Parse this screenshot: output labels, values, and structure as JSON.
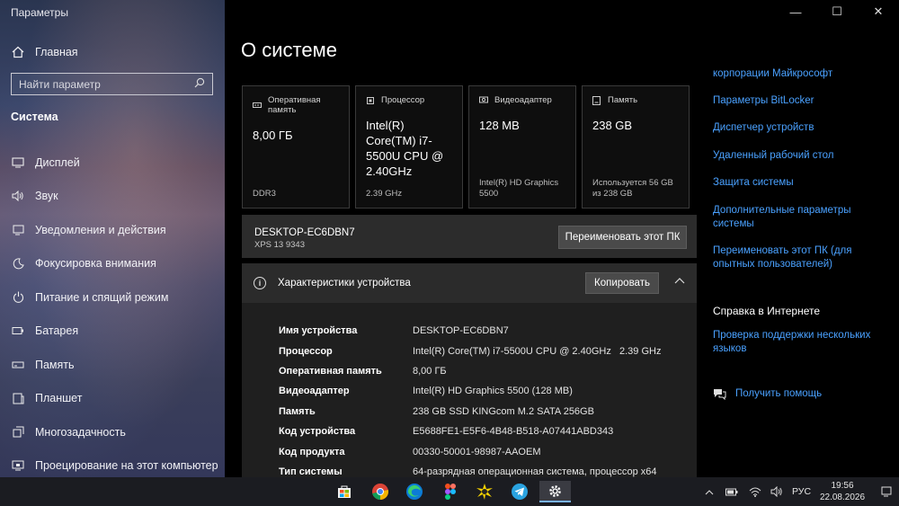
{
  "window": {
    "app_title": "Параметры",
    "controls": {
      "minimize": "—",
      "maximize": "☐",
      "close": "✕"
    }
  },
  "sidebar": {
    "home_label": "Главная",
    "search_placeholder": "Найти параметр",
    "section_label": "Система",
    "items": [
      {
        "label": "Дисплей",
        "icon": "display-icon"
      },
      {
        "label": "Звук",
        "icon": "speaker-icon"
      },
      {
        "label": "Уведомления и действия",
        "icon": "notification-icon"
      },
      {
        "label": "Фокусировка внимания",
        "icon": "moon-icon"
      },
      {
        "label": "Питание и спящий режим",
        "icon": "power-icon"
      },
      {
        "label": "Батарея",
        "icon": "battery-icon"
      },
      {
        "label": "Память",
        "icon": "storage-icon"
      },
      {
        "label": "Планшет",
        "icon": "tablet-icon"
      },
      {
        "label": "Многозадачность",
        "icon": "multitask-icon"
      },
      {
        "label": "Проецирование на этот компьютер",
        "icon": "project-icon"
      }
    ]
  },
  "main": {
    "page_title": "О системе",
    "cards": [
      {
        "title": "Оперативная память",
        "value": "8,00 ГБ",
        "footer": "DDR3",
        "icon": "ram-icon"
      },
      {
        "title": "Процессор",
        "value": "Intel(R) Core(TM) i7-5500U CPU @ 2.40GHz",
        "footer": "2.39 GHz",
        "icon": "cpu-icon"
      },
      {
        "title": "Видеоадаптер",
        "value": "128 MB",
        "footer": "Intel(R) HD Graphics 5500",
        "icon": "gpu-icon"
      },
      {
        "title": "Память",
        "value": "238 GB",
        "footer": "Используется 56 GB из 238 GB",
        "icon": "disk-icon"
      }
    ],
    "pc": {
      "name": "DESKTOP-EC6DBN7",
      "model": "XPS 13 9343",
      "rename_button": "Переименовать этот ПК"
    },
    "specs": {
      "title": "Характеристики устройства",
      "copy_button": "Копировать",
      "rows": [
        {
          "key": "Имя устройства",
          "value": "DESKTOP-EC6DBN7"
        },
        {
          "key": "Процессор",
          "value": "Intel(R) Core(TM) i7-5500U CPU @ 2.40GHz   2.39 GHz"
        },
        {
          "key": "Оперативная память",
          "value": "8,00 ГБ"
        },
        {
          "key": "Видеоадаптер",
          "value": "Intel(R) HD Graphics 5500 (128 MB)"
        },
        {
          "key": "Память",
          "value": "238 GB SSD KINGcom M.2 SATA 256GB"
        },
        {
          "key": "Код устройства",
          "value": "E5688FE1-E5F6-4B48-B518-A07441ABD343"
        },
        {
          "key": "Код продукта",
          "value": "00330-50001-98987-AAOEM"
        },
        {
          "key": "Тип системы",
          "value": "64-разрядная операционная система, процессор x64"
        }
      ]
    }
  },
  "related": {
    "links": [
      "корпорации Майкрософт",
      "Параметры BitLocker",
      "Диспетчер устройств",
      "Удаленный рабочий стол",
      "Защита системы",
      "Дополнительные параметры системы",
      "Переименовать этот ПК (для опытных пользователей)"
    ],
    "help_title": "Справка в Интернете",
    "help_link": "Проверка поддержки нескольких языков",
    "get_help": "Получить помощь"
  },
  "taskbar": {
    "apps": [
      "store-icon",
      "chrome-icon",
      "edge-icon",
      "figma-icon",
      "sunburst-icon",
      "telegram-icon",
      "settings-icon"
    ],
    "language": "РУС",
    "time": "19:56",
    "date": "22.08.2026"
  },
  "colors": {
    "accent_link": "#4aa1ff",
    "taskbar_active": "#7ab4ff"
  }
}
